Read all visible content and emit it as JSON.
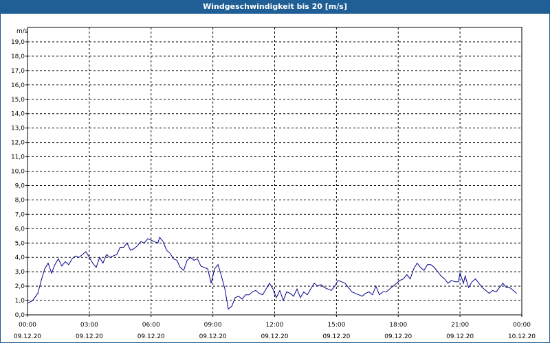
{
  "window": {
    "title": "Windgeschwindigkeit bis 20 [m/s]"
  },
  "chart_data": {
    "type": "line",
    "title": "Windgeschwindigkeit bis 20 [m/s]",
    "ylabel": "m/s",
    "xlabel": "",
    "ylim": [
      0,
      20
    ],
    "xlim_hours": [
      0,
      24
    ],
    "y_ticks": [
      "0,0",
      "1,0",
      "2,0",
      "3,0",
      "4,0",
      "5,0",
      "6,0",
      "7,0",
      "8,0",
      "9,0",
      "10,0",
      "11,0",
      "12,0",
      "13,0",
      "14,0",
      "15,0",
      "16,0",
      "17,0",
      "18,0",
      "19,0"
    ],
    "x_ticks": [
      {
        "time": "00:00",
        "date": "09.12.20"
      },
      {
        "time": "03:00",
        "date": "09.12.20"
      },
      {
        "time": "06:00",
        "date": "09.12.20"
      },
      {
        "time": "09:00",
        "date": "09.12.20"
      },
      {
        "time": "12:00",
        "date": "09.12.20"
      },
      {
        "time": "15:00",
        "date": "09.12.20"
      },
      {
        "time": "18:00",
        "date": "09.12.20"
      },
      {
        "time": "21:00",
        "date": "09.12.20"
      },
      {
        "time": "00:00",
        "date": "10.12.20"
      }
    ],
    "grid": true,
    "line_color": "#00008b",
    "series": [
      {
        "name": "",
        "points": [
          [
            "00:00",
            0.8
          ],
          [
            "00:15",
            1.0
          ],
          [
            "00:30",
            1.5
          ],
          [
            "00:40",
            2.4
          ],
          [
            "00:50",
            3.2
          ],
          [
            "01:00",
            3.6
          ],
          [
            "01:10",
            2.9
          ],
          [
            "01:20",
            3.5
          ],
          [
            "01:30",
            3.9
          ],
          [
            "01:40",
            3.4
          ],
          [
            "01:50",
            3.7
          ],
          [
            "02:00",
            3.5
          ],
          [
            "02:10",
            3.9
          ],
          [
            "02:20",
            4.1
          ],
          [
            "02:30",
            4.0
          ],
          [
            "02:40",
            4.2
          ],
          [
            "02:50",
            4.4
          ],
          [
            "03:00",
            4.0
          ],
          [
            "03:10",
            3.6
          ],
          [
            "03:20",
            3.3
          ],
          [
            "03:30",
            4.0
          ],
          [
            "03:40",
            3.6
          ],
          [
            "03:50",
            4.2
          ],
          [
            "04:00",
            4.0
          ],
          [
            "04:10",
            4.1
          ],
          [
            "04:20",
            4.2
          ],
          [
            "04:30",
            4.7
          ],
          [
            "04:40",
            4.7
          ],
          [
            "04:50",
            5.0
          ],
          [
            "05:00",
            4.5
          ],
          [
            "05:10",
            4.6
          ],
          [
            "05:20",
            4.8
          ],
          [
            "05:30",
            5.1
          ],
          [
            "05:40",
            5.0
          ],
          [
            "05:50",
            5.3
          ],
          [
            "06:00",
            5.2
          ],
          [
            "06:10",
            5.1
          ],
          [
            "06:20",
            5.0
          ],
          [
            "06:25",
            5.4
          ],
          [
            "06:35",
            5.1
          ],
          [
            "06:45",
            4.5
          ],
          [
            "06:55",
            4.3
          ],
          [
            "07:05",
            3.9
          ],
          [
            "07:15",
            3.8
          ],
          [
            "07:25",
            3.3
          ],
          [
            "07:35",
            3.1
          ],
          [
            "07:45",
            3.8
          ],
          [
            "07:55",
            4.0
          ],
          [
            "08:05",
            3.8
          ],
          [
            "08:15",
            3.9
          ],
          [
            "08:25",
            3.4
          ],
          [
            "08:35",
            3.3
          ],
          [
            "08:45",
            3.2
          ],
          [
            "08:55",
            2.2
          ],
          [
            "09:05",
            3.2
          ],
          [
            "09:15",
            3.5
          ],
          [
            "09:25",
            2.7
          ],
          [
            "09:35",
            1.8
          ],
          [
            "09:45",
            0.4
          ],
          [
            "09:55",
            0.6
          ],
          [
            "10:05",
            1.2
          ],
          [
            "10:15",
            1.3
          ],
          [
            "10:25",
            1.1
          ],
          [
            "10:35",
            1.4
          ],
          [
            "10:45",
            1.4
          ],
          [
            "10:55",
            1.6
          ],
          [
            "11:05",
            1.7
          ],
          [
            "11:15",
            1.5
          ],
          [
            "11:25",
            1.4
          ],
          [
            "11:35",
            1.8
          ],
          [
            "11:45",
            2.2
          ],
          [
            "11:55",
            1.8
          ],
          [
            "12:05",
            1.2
          ],
          [
            "12:15",
            1.7
          ],
          [
            "12:25",
            1.0
          ],
          [
            "12:35",
            1.6
          ],
          [
            "12:45",
            1.5
          ],
          [
            "12:55",
            1.3
          ],
          [
            "13:05",
            1.8
          ],
          [
            "13:15",
            1.2
          ],
          [
            "13:25",
            1.6
          ],
          [
            "13:35",
            1.4
          ],
          [
            "13:45",
            1.8
          ],
          [
            "13:55",
            2.2
          ],
          [
            "14:05",
            2.0
          ],
          [
            "14:15",
            2.1
          ],
          [
            "14:25",
            1.9
          ],
          [
            "14:35",
            1.8
          ],
          [
            "14:45",
            1.7
          ],
          [
            "14:55",
            2.0
          ],
          [
            "15:05",
            2.4
          ],
          [
            "15:15",
            2.3
          ],
          [
            "15:25",
            2.2
          ],
          [
            "15:35",
            1.9
          ],
          [
            "15:45",
            1.6
          ],
          [
            "15:55",
            1.5
          ],
          [
            "16:05",
            1.4
          ],
          [
            "16:15",
            1.3
          ],
          [
            "16:25",
            1.5
          ],
          [
            "16:35",
            1.6
          ],
          [
            "16:45",
            1.4
          ],
          [
            "16:55",
            2.0
          ],
          [
            "17:05",
            1.4
          ],
          [
            "17:15",
            1.6
          ],
          [
            "17:25",
            1.6
          ],
          [
            "17:35",
            1.8
          ],
          [
            "17:45",
            2.0
          ],
          [
            "17:55",
            2.2
          ],
          [
            "18:05",
            2.4
          ],
          [
            "18:15",
            2.5
          ],
          [
            "18:25",
            2.8
          ],
          [
            "18:35",
            2.5
          ],
          [
            "18:45",
            3.2
          ],
          [
            "18:55",
            3.6
          ],
          [
            "19:05",
            3.3
          ],
          [
            "19:15",
            3.1
          ],
          [
            "19:25",
            3.5
          ],
          [
            "19:35",
            3.5
          ],
          [
            "19:45",
            3.3
          ],
          [
            "19:55",
            3.0
          ],
          [
            "20:05",
            2.7
          ],
          [
            "20:15",
            2.5
          ],
          [
            "20:25",
            2.2
          ],
          [
            "20:35",
            2.4
          ],
          [
            "20:45",
            2.3
          ],
          [
            "20:55",
            2.3
          ],
          [
            "21:00",
            2.9
          ],
          [
            "21:10",
            2.2
          ],
          [
            "21:15",
            2.7
          ],
          [
            "21:25",
            1.9
          ],
          [
            "21:35",
            2.3
          ],
          [
            "21:45",
            2.5
          ],
          [
            "21:55",
            2.2
          ],
          [
            "22:05",
            1.9
          ],
          [
            "22:15",
            1.7
          ],
          [
            "22:25",
            1.5
          ],
          [
            "22:35",
            1.7
          ],
          [
            "22:45",
            1.6
          ],
          [
            "22:55",
            1.9
          ],
          [
            "23:05",
            2.2
          ],
          [
            "23:15",
            1.9
          ],
          [
            "23:25",
            1.9
          ],
          [
            "23:35",
            1.7
          ],
          [
            "23:45",
            1.5
          ]
        ]
      }
    ]
  }
}
